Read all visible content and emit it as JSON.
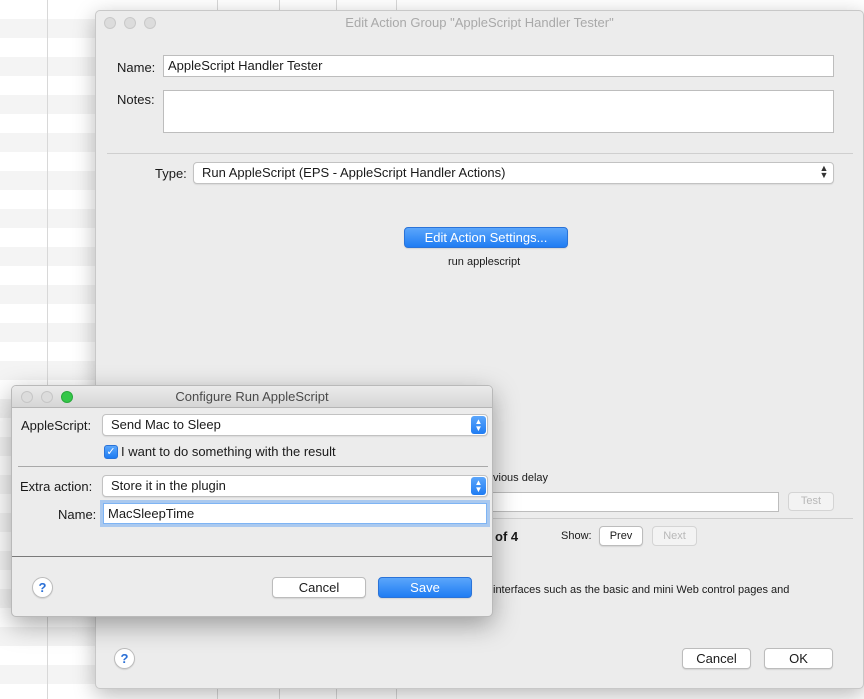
{
  "main_window": {
    "title": "Edit Action Group \"AppleScript Handler Tester\"",
    "name_label": "Name:",
    "name_value": "AppleScript Handler Tester",
    "notes_label": "Notes:",
    "notes_value": "",
    "type_label": "Type:",
    "type_value": "Run AppleScript (EPS - AppleScript Handler Actions)",
    "edit_settings_button": "Edit Action Settings...",
    "summary_text": "run applescript",
    "delay_text_fragment": "vious delay",
    "test_button": "Test",
    "page_fragment": "of 4",
    "show_label": "Show:",
    "prev_button": "Prev",
    "next_button": "Next",
    "description_fragment": "interfaces such as the basic and mini Web control pages and",
    "help_button": "?",
    "cancel_button": "Cancel",
    "ok_button": "OK"
  },
  "dialog": {
    "title": "Configure Run AppleScript",
    "applescript_label": "AppleScript:",
    "applescript_value": "Send Mac to Sleep",
    "checkbox_label": "I want to do something with the result",
    "checkbox_checked": true,
    "extra_action_label": "Extra action:",
    "extra_action_value": "Store it in the plugin",
    "name_label": "Name:",
    "name_value": "MacSleepTime",
    "help_button": "?",
    "cancel_button": "Cancel",
    "save_button": "Save"
  },
  "colors": {
    "accent_blue": "#1f7cf3",
    "traffic_close": "#fc5f57",
    "traffic_min": "#fdbc2e",
    "traffic_zoom": "#34c749"
  }
}
